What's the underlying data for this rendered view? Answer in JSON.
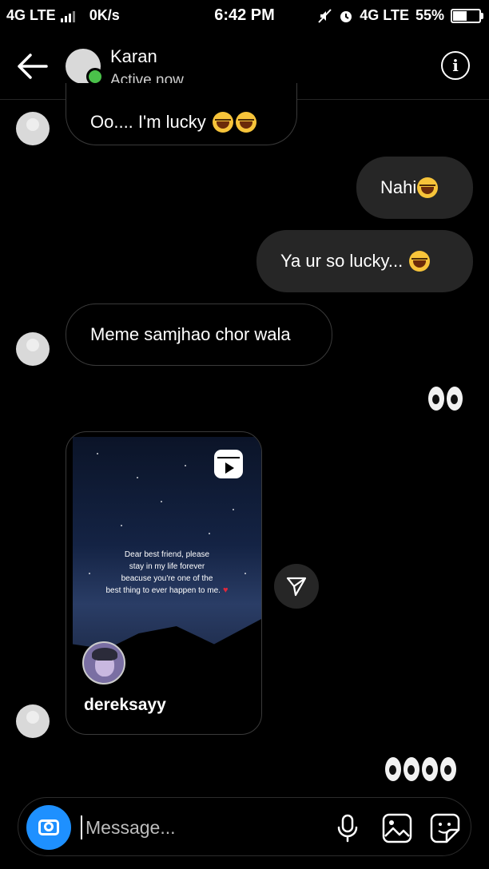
{
  "status_bar": {
    "network": "4G LTE",
    "speed": "0K/s",
    "time": "6:42 PM",
    "network_right": "4G LTE",
    "battery": "55%",
    "battery_level": 0.55
  },
  "header": {
    "contact_name": "Karan",
    "status": "Active now"
  },
  "messages": [
    {
      "from": "them",
      "text": "Oo.... I'm lucky",
      "emoji": [
        "laughing-emoji",
        "laughing-emoji"
      ]
    },
    {
      "from": "me",
      "text": "Nahi",
      "emoji": [
        "sweat-smile-emoji"
      ]
    },
    {
      "from": "me",
      "text": "Ya ur so lucky...",
      "emoji": [
        "laughing-emoji"
      ]
    },
    {
      "from": "them",
      "text": "Meme samjhao chor wala"
    },
    {
      "from": "me",
      "emoji": [
        "eyes-emoji",
        "eyes-emoji"
      ]
    },
    {
      "from": "them",
      "type": "reel",
      "reel": {
        "caption": [
          "Dear best friend, please",
          "stay in my life forever",
          "beacuse you're one of the",
          "best thing to ever happen to me."
        ],
        "username": "dereksayy"
      }
    },
    {
      "from": "me",
      "emoji": [
        "eyes-emoji",
        "eyes-emoji",
        "eyes-emoji",
        "eyes-emoji"
      ]
    }
  ],
  "composer": {
    "placeholder": "Message..."
  },
  "icons": {
    "back": "back-arrow-icon",
    "info": "info-icon",
    "reel": "reel-icon",
    "share": "send-icon",
    "camera": "camera-icon",
    "mic": "microphone-icon",
    "gallery": "gallery-icon",
    "sticker": "sticker-icon"
  },
  "colors": {
    "background": "#000000",
    "outgoing_bubble": "#262626",
    "camera_button": "#1e90ff",
    "presence": "#4ac14a"
  }
}
